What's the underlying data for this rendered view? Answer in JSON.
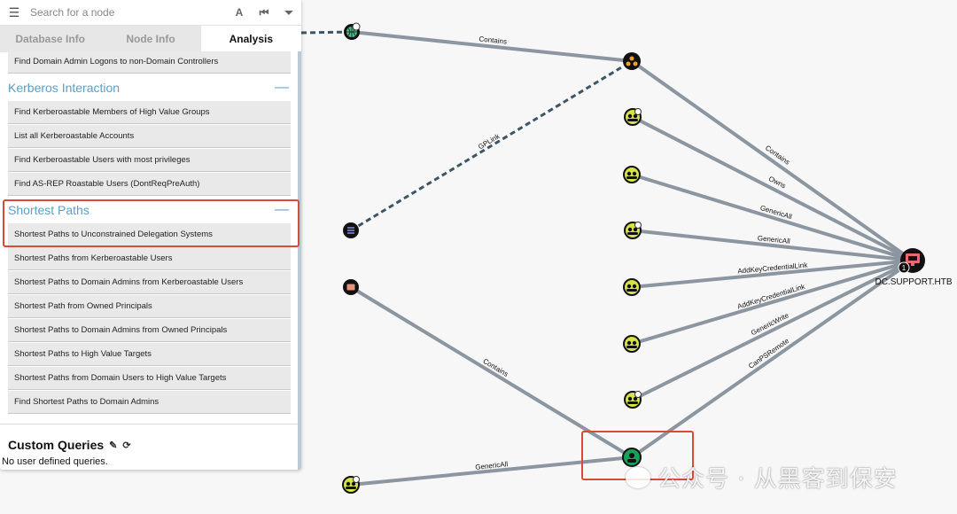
{
  "search": {
    "placeholder": "Search for a node"
  },
  "tabs": [
    {
      "label": "Database Info",
      "active": false
    },
    {
      "label": "Node Info",
      "active": false
    },
    {
      "label": "Analysis",
      "active": true
    }
  ],
  "queries_top": [
    "Find Domain Admin Logons to non-Domain Controllers"
  ],
  "sections": [
    {
      "title": "Kerberos Interaction",
      "toggle": "—",
      "queries": [
        "Find Kerberoastable Members of High Value Groups",
        "List all Kerberoastable Accounts",
        "Find Kerberoastable Users with most privileges",
        "Find AS-REP Roastable Users (DontReqPreAuth)"
      ]
    },
    {
      "title": "Shortest Paths",
      "toggle": "—",
      "queries": [
        "Shortest Paths to Unconstrained Delegation Systems",
        "Shortest Paths from Kerberoastable Users",
        "Shortest Paths to Domain Admins from Kerberoastable Users",
        "Shortest Path from Owned Principals",
        "Shortest Paths to Domain Admins from Owned Principals",
        "Shortest Paths to High Value Targets",
        "Shortest Paths from Domain Users to High Value Targets",
        "Find Shortest Paths to Domain Admins"
      ]
    }
  ],
  "custom": {
    "title": "Custom Queries",
    "empty": "No user defined queries."
  },
  "graph": {
    "target_label": "DC.SUPPORT.HTB",
    "target_badge": "1",
    "edges": [
      "Contains",
      "GPLink",
      "Contains",
      "Owns",
      "GenericAll",
      "GenericAll",
      "AddKeyCredentialLink",
      "AddKeyCredentialLink",
      "GenericWrite",
      "CanPSRemote",
      "Contains",
      "GenericAll"
    ]
  },
  "colors": {
    "accent": "#5aa0c8",
    "highlight": "#d94a38",
    "user_node": "#d7e34a",
    "edge": "#8b96a0"
  },
  "watermark": "公众号 · 从黑客到保安"
}
